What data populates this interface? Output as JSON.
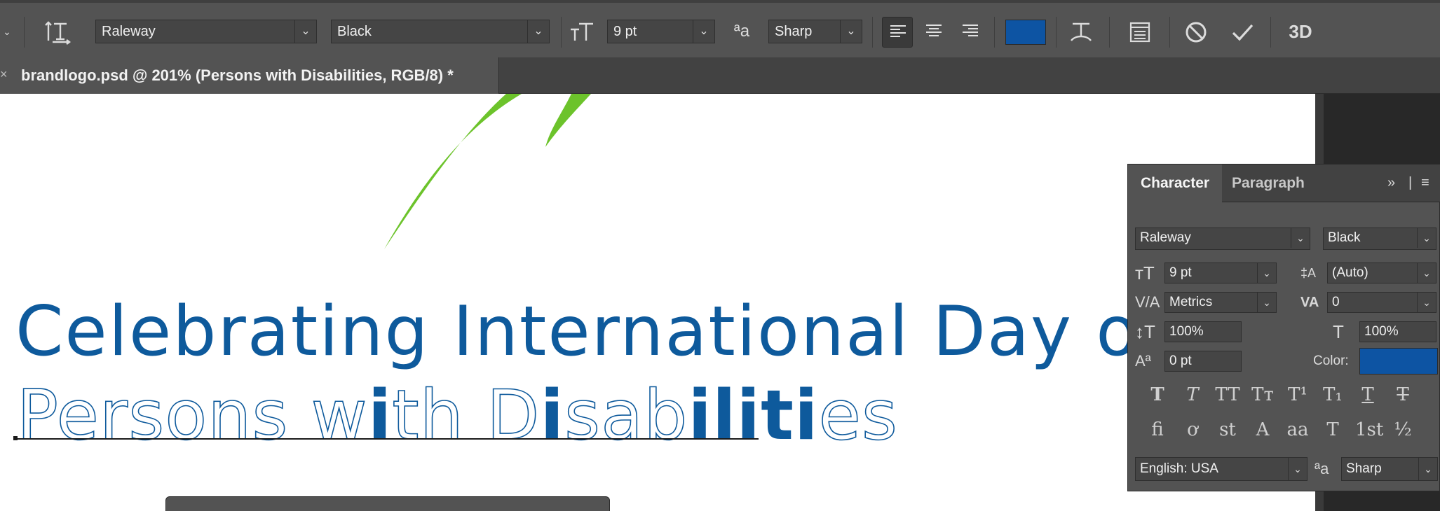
{
  "options_bar": {
    "font_family": "Raleway",
    "font_style": "Black",
    "font_size": "9 pt",
    "antialias": "Sharp",
    "text_color": "#0d54a3",
    "icons": {
      "orientation": "text-orientation-icon",
      "size": "font-size-icon",
      "antialias": "antialias-icon",
      "warp": "warp-text-icon",
      "panels": "character-panels-icon",
      "cancel": "cancel-icon",
      "commit": "commit-icon",
      "threed": "3d-icon"
    },
    "threed_label": "3D"
  },
  "document": {
    "tab_title": "brandlogo.psd @ 201% (Persons with Disabilities, RGB/8) *"
  },
  "canvas": {
    "headline": "Celebrating International Day of",
    "subline_parts": [
      {
        "text": "Persons w",
        "style": "thin"
      },
      {
        "text": "i",
        "style": "bold"
      },
      {
        "text": "th D",
        "style": "thin"
      },
      {
        "text": "i",
        "style": "bold"
      },
      {
        "text": "sab",
        "style": "thin"
      },
      {
        "text": "i",
        "style": "bold"
      },
      {
        "text": "l",
        "style": "bold"
      },
      {
        "text": "i",
        "style": "bold"
      },
      {
        "text": "t",
        "style": "bold"
      },
      {
        "text": "i",
        "style": "bold"
      },
      {
        "text": "es",
        "style": "thin"
      }
    ],
    "brand_color": "#0e5a9c",
    "leaf_color": "#6cc32b"
  },
  "character_panel": {
    "tabs": [
      "Character",
      "Paragraph"
    ],
    "font_family": "Raleway",
    "font_style": "Black",
    "font_size": "9 pt",
    "leading": "(Auto)",
    "kerning": "Metrics",
    "tracking": "0",
    "vertical_scale": "100%",
    "horizontal_scale": "100%",
    "baseline_shift": "0 pt",
    "color_label": "Color:",
    "color": "#0d54a3",
    "language": "English: USA",
    "antialias": "Sharp",
    "type_style_buttons": [
      "T",
      "T",
      "TT",
      "Tт",
      "T¹",
      "T₁",
      "T",
      "T"
    ],
    "opentype_buttons": [
      "fi",
      "ơ",
      "st",
      "A",
      "aa",
      "T",
      "1st",
      "½"
    ]
  }
}
